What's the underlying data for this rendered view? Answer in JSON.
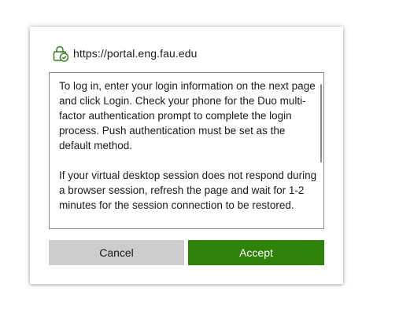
{
  "dialog": {
    "site_url": "https://portal.eng.fau.edu",
    "site_icon": "lock-check-icon",
    "message_paragraphs": [
      "To log in, enter your login information on the next page and click Login. Check your phone for the Duo multi-factor authentication prompt to complete the login process. Push authentication must be set as the default method.",
      "If your virtual desktop session does not respond during a browser session, refresh the page and wait for 1-2 minutes for the session connection to be restored."
    ],
    "cancel_label": "Cancel",
    "accept_label": "Accept"
  },
  "colors": {
    "accent": "#2f820a",
    "cancel_bg": "#cccccc",
    "icon_green": "#3a7d1e"
  }
}
